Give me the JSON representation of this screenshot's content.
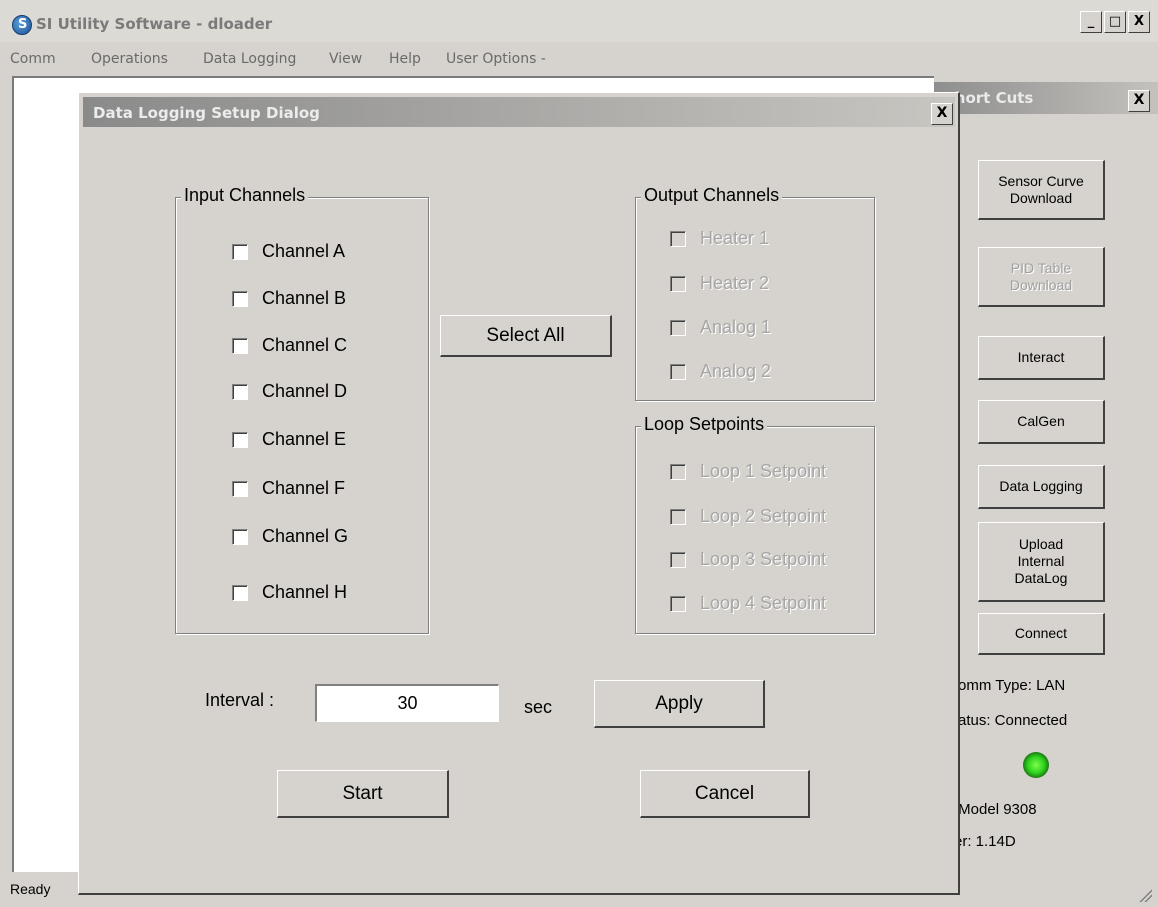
{
  "app": {
    "title": "SI Utility Software - dloader"
  },
  "window_buttons": {
    "minimize": "_",
    "maximize": "□",
    "close": "X"
  },
  "menu": [
    "Comm",
    "Operations",
    "Data Logging",
    "View",
    "Help",
    "User Options -"
  ],
  "status": "Ready",
  "shortcuts": {
    "title": "Short Cuts",
    "close": "X",
    "buttons": [
      {
        "label": "Sensor Curve\nDownload",
        "enabled": true
      },
      {
        "label": "PID Table\nDownload",
        "enabled": false
      },
      {
        "label": "Interact",
        "enabled": true
      },
      {
        "label": "CalGen",
        "enabled": true
      },
      {
        "label": "Data Logging",
        "enabled": true
      },
      {
        "label": "Upload\nInternal\nDataLog",
        "enabled": true
      },
      {
        "label": "Connect",
        "enabled": true
      }
    ],
    "comm_type": "omm Type:  LAN",
    "status": "atus:  Connected",
    "led_color": "#2ed11e",
    "model": ",Model 9308",
    "version": "er:   1.14D"
  },
  "dialog": {
    "title": "Data Logging Setup Dialog",
    "close": "X",
    "input_group": {
      "legend": "Input Channels",
      "channels": [
        "Channel A",
        "Channel B",
        "Channel C",
        "Channel D",
        "Channel E",
        "Channel F",
        "Channel G",
        "Channel H"
      ]
    },
    "select_all": "Select All",
    "output_group": {
      "legend": "Output Channels",
      "channels": [
        "Heater 1",
        "Heater 2",
        "Analog 1",
        "Analog 2"
      ]
    },
    "loop_group": {
      "legend": "Loop Setpoints",
      "channels": [
        "Loop 1 Setpoint",
        "Loop 2 Setpoint",
        "Loop 3 Setpoint",
        "Loop 4 Setpoint"
      ]
    },
    "interval_label": "Interval :",
    "interval_value": "30",
    "interval_unit": "sec",
    "apply": "Apply",
    "start": "Start",
    "cancel": "Cancel"
  }
}
